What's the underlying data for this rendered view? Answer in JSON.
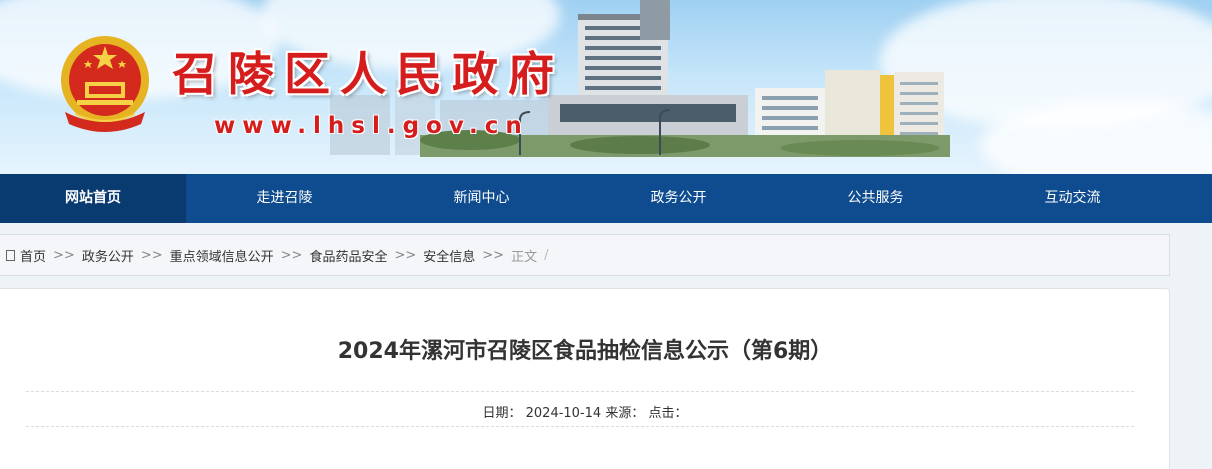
{
  "header": {
    "site_title": "召陵区人民政府",
    "site_url": "www.lhsl.gov.cn",
    "emblem_icon": "national-emblem-icon",
    "brand_red": "#d61d1d"
  },
  "nav": {
    "items": [
      {
        "label": "网站首页"
      },
      {
        "label": "走进召陵"
      },
      {
        "label": "新闻中心"
      },
      {
        "label": "政务公开"
      },
      {
        "label": "公共服务"
      },
      {
        "label": "互动交流"
      }
    ],
    "active_index": 0,
    "bg_color": "#0e4c8f"
  },
  "breadcrumb": {
    "icon": "home-icon",
    "items": [
      "首页",
      "政务公开",
      "重点领域信息公开",
      "食品药品安全",
      "安全信息",
      "正文"
    ],
    "separator": ">>",
    "trailing": "/"
  },
  "article": {
    "title": "2024年漯河市召陵区食品抽检信息公示（第6期）",
    "date_label": "日期：",
    "date": "2024-10-14",
    "source_label": "来源：",
    "source": "",
    "clicks_label": "点击：",
    "clicks": ""
  }
}
